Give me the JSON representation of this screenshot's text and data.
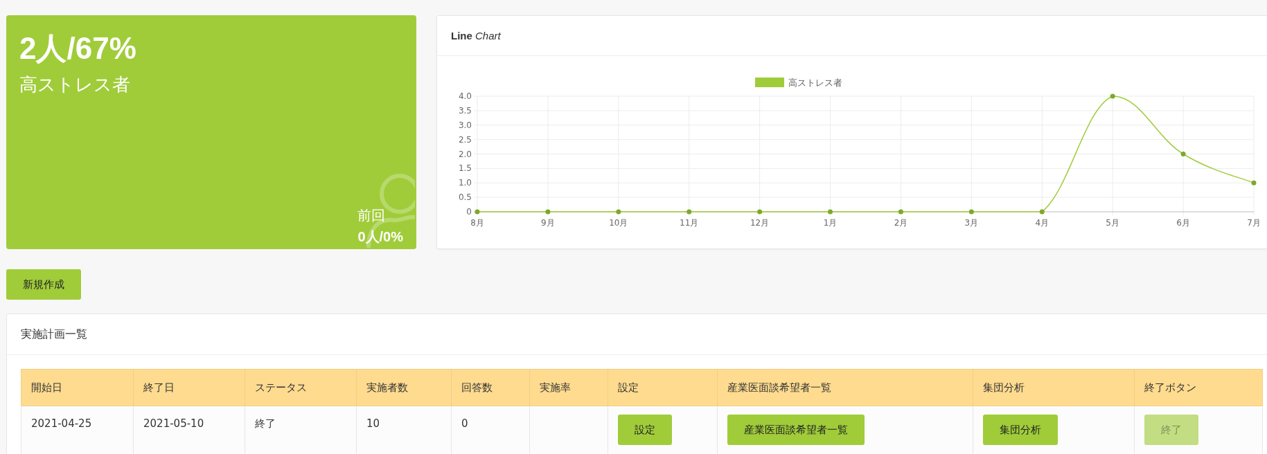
{
  "summary": {
    "value": "2人/67%",
    "label": "高ストレス者",
    "previous_label": "前回",
    "previous_value": "0人/0%"
  },
  "chart_card": {
    "title": "**Line** *Chart*",
    "chart_data": {
      "type": "line",
      "categories": [
        "8月",
        "9月",
        "10月",
        "11月",
        "12月",
        "1月",
        "2月",
        "3月",
        "4月",
        "5月",
        "6月",
        "7月"
      ],
      "grid": true,
      "series": [
        {
          "name": "高ストレス者",
          "color": "#a0cc3a",
          "marker": "circle",
          "values": [
            0,
            0,
            0,
            0,
            0,
            0,
            0,
            0,
            0,
            4,
            2,
            1
          ]
        }
      ],
      "ylim": [
        0,
        4
      ],
      "yticks": [
        {
          "value": 0,
          "label": "0"
        },
        {
          "value": 0.5,
          "label": "0.5"
        },
        {
          "value": 1,
          "label": "1.0"
        },
        {
          "value": 1.5,
          "label": "1.5"
        },
        {
          "value": 2,
          "label": "2.0"
        },
        {
          "value": 2.5,
          "label": "2.5"
        },
        {
          "value": 3,
          "label": "3.0"
        },
        {
          "value": 3.5,
          "label": "3.5"
        },
        {
          "value": 4,
          "label": "4.0"
        }
      ]
    }
  },
  "new_button": "新規作成",
  "plan_list": {
    "title": "実施計画一覧",
    "columns": [
      "開始日",
      "終了日",
      "ステータス",
      "実施者数",
      "回答数",
      "実施率",
      "設定",
      "産業医面談希望者一覧",
      "集団分析",
      "終了ボタン"
    ],
    "rows": [
      {
        "cells": [
          {
            "kind": "text",
            "text": "2021-04-25"
          },
          {
            "kind": "text",
            "text": "2021-05-10"
          },
          {
            "kind": "text",
            "text": "終了"
          },
          {
            "kind": "text",
            "text": "10"
          },
          {
            "kind": "text",
            "text": "0"
          },
          {
            "kind": "empty"
          },
          {
            "kind": "button",
            "text": "設定",
            "disabled": false
          },
          {
            "kind": "button",
            "text": "産業医面談希望者一覧",
            "disabled": false
          },
          {
            "kind": "button",
            "text": "集団分析",
            "disabled": false
          },
          {
            "kind": "button",
            "text": "終了",
            "disabled": true
          }
        ]
      }
    ]
  }
}
